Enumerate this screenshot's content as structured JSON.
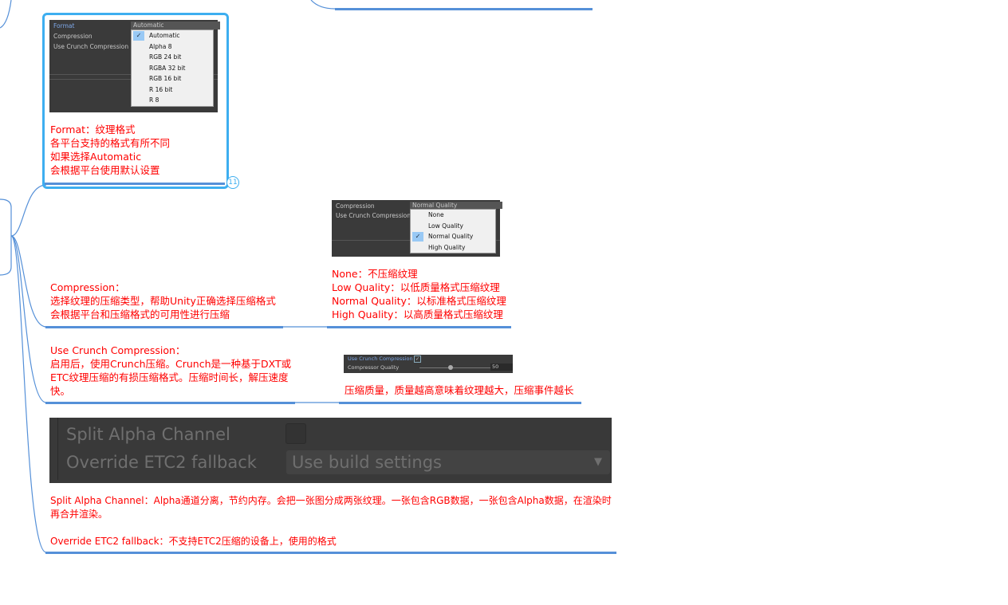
{
  "top_node": {
    "text": "..."
  },
  "format_node": {
    "ui": {
      "label_format": "Format",
      "label_compression": "Compression",
      "label_crunch": "Use Crunch Compression",
      "selected": "Automatic",
      "options": [
        "Automatic",
        "Alpha 8",
        "RGB 24 bit",
        "RGBA 32 bit",
        "RGB 16 bit",
        "R 16 bit",
        "R 8"
      ],
      "checked_index": 0
    },
    "text": "Format：纹理格式\n各平台支持的格式有所不同\n如果选择Automatic\n会根据平台使用默认设置",
    "badge": "11"
  },
  "compression_node": {
    "text": "Compression：\n选择纹理的压缩类型，帮助Unity正确选择压缩格式\n会根据平台和压缩格式的可用性进行压缩",
    "child": {
      "ui": {
        "label_compression": "Compression",
        "label_crunch": "Use Crunch Compression",
        "selected": "Normal Quality",
        "options": [
          "None",
          "Low Quality",
          "Normal Quality",
          "High Quality"
        ],
        "checked_index": 2
      },
      "text": "None：不压缩纹理\nLow Quality：以低质量格式压缩纹理\nNormal Quality：以标准格式压缩纹理\nHigh Quality：以高质量格式压缩纹理"
    }
  },
  "crunch_node": {
    "text": "Use Crunch Compression：\n启用后，使用Crunch压缩。Crunch是一种基于DXT或ETC纹理压缩的有损压缩格式。压缩时间长，解压速度快。",
    "child": {
      "ui": {
        "label_crunch": "Use Crunch Compression",
        "label_quality": "Compressor Quality",
        "quality_value": "50",
        "quality_fraction": 0.5,
        "crunch_checked": true
      },
      "text": "压缩质量，质量越高意味着纹理越大，压缩事件越长"
    }
  },
  "split_node": {
    "ui": {
      "label_split": "Split Alpha Channel",
      "label_override": "Override ETC2 fallback",
      "override_value": "Use build settings"
    },
    "text": "Split Alpha Channel：Alpha通道分离，节约内存。会把一张图分成两张纹理。一张包含RGB数据，一张包含Alpha数据，在渲染时再合并渲染。\n\nOverride ETC2 fallback：不支持ETC2压缩的设备上，使用的格式"
  },
  "colors": {
    "connector": "#5590d8",
    "text": "#ff0000",
    "selected_border": "#3daef0"
  }
}
